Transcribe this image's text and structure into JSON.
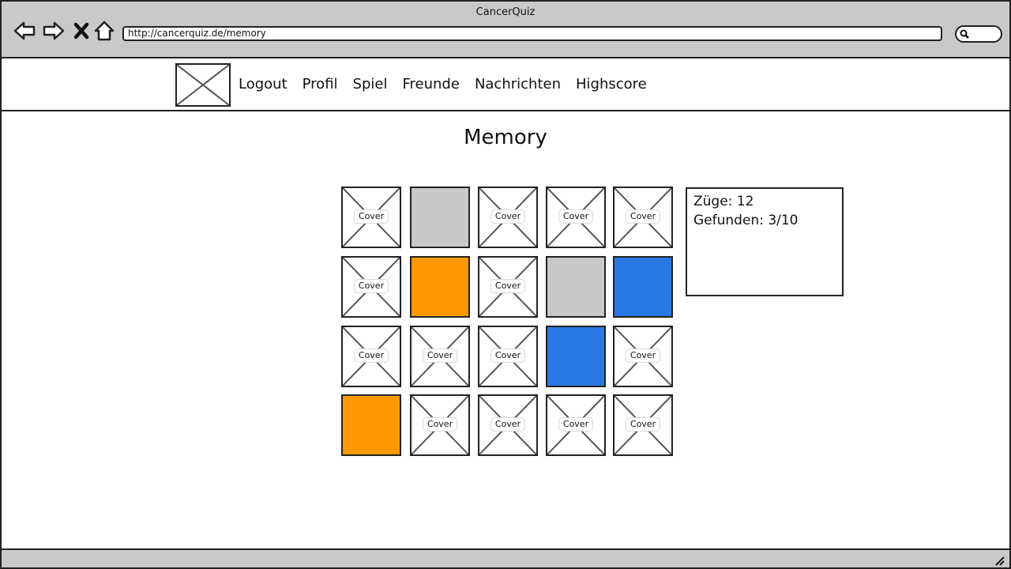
{
  "browser": {
    "window_title": "CancerQuiz",
    "url": "http://cancerquiz.de/memory",
    "icons": [
      "back-arrow-icon",
      "forward-arrow-icon",
      "stop-icon",
      "home-icon",
      "search-icon"
    ]
  },
  "nav": {
    "logo_icon": "image-placeholder-icon",
    "links": [
      "Logout",
      "Profil",
      "Spiel",
      "Freunde",
      "Nachrichten",
      "Highscore"
    ]
  },
  "page": {
    "title": "Memory"
  },
  "board": {
    "cover_label": "Cover",
    "rows": 4,
    "cols": 5,
    "cards": [
      {
        "state": "cover"
      },
      {
        "state": "open",
        "color": "#c8c8c8"
      },
      {
        "state": "cover"
      },
      {
        "state": "cover"
      },
      {
        "state": "cover"
      },
      {
        "state": "cover"
      },
      {
        "state": "open",
        "color": "#ff9900"
      },
      {
        "state": "cover"
      },
      {
        "state": "open",
        "color": "#c8c8c8"
      },
      {
        "state": "open",
        "color": "#2a78e4"
      },
      {
        "state": "cover"
      },
      {
        "state": "cover"
      },
      {
        "state": "cover"
      },
      {
        "state": "open",
        "color": "#2a78e4"
      },
      {
        "state": "cover"
      },
      {
        "state": "open",
        "color": "#ff9900"
      },
      {
        "state": "cover"
      },
      {
        "state": "cover"
      },
      {
        "state": "cover"
      },
      {
        "state": "cover"
      }
    ]
  },
  "stats": {
    "moves": "Züge: 12",
    "found": "Gefunden: 3/10"
  },
  "colors": {
    "chrome": "#c9c9c9",
    "orange": "#ff9900",
    "blue": "#2a78e4",
    "grey": "#c8c8c8"
  }
}
